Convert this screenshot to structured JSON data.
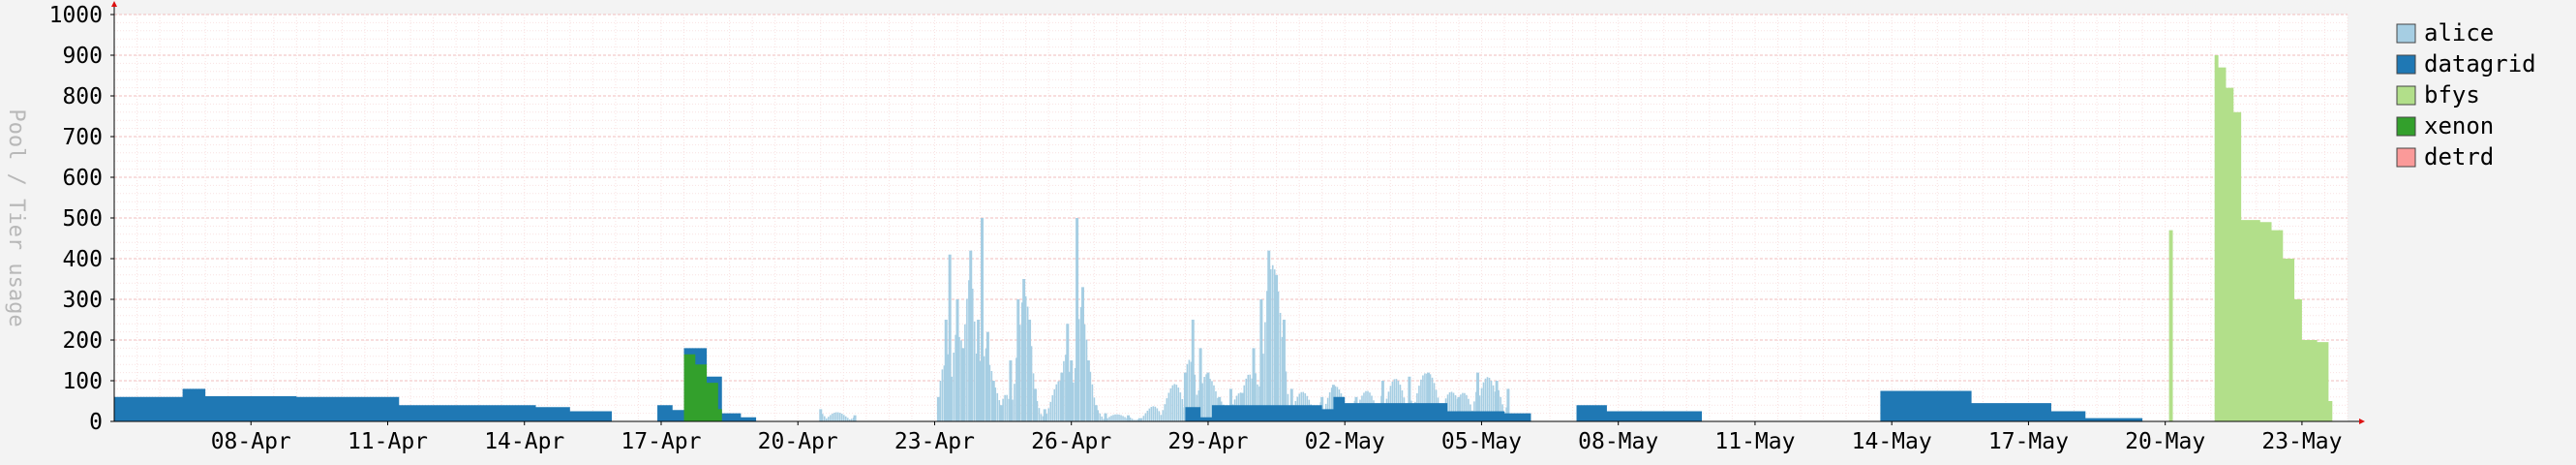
{
  "chart_data": {
    "type": "area",
    "title": "",
    "xlabel": "",
    "ylabel": "Pool / Tier usage",
    "ylim": [
      0,
      1000
    ],
    "yticks": [
      0,
      100,
      200,
      300,
      400,
      500,
      600,
      700,
      800,
      900,
      1000
    ],
    "xlim": [
      "2024-04-05",
      "2024-05-24"
    ],
    "xticks": [
      "08-Apr",
      "11-Apr",
      "14-Apr",
      "17-Apr",
      "20-Apr",
      "23-Apr",
      "26-Apr",
      "29-Apr",
      "02-May",
      "05-May",
      "08-May",
      "11-May",
      "14-May",
      "17-May",
      "20-May",
      "23-May"
    ],
    "xtick_dates": [
      "2024-04-08",
      "2024-04-11",
      "2024-04-14",
      "2024-04-17",
      "2024-04-20",
      "2024-04-23",
      "2024-04-26",
      "2024-04-29",
      "2024-05-02",
      "2024-05-05",
      "2024-05-08",
      "2024-05-11",
      "2024-05-14",
      "2024-05-17",
      "2024-05-20",
      "2024-05-23"
    ],
    "grid": true,
    "legend_position": "right",
    "series": [
      {
        "name": "alice",
        "color": "#a6cee3",
        "style": "spikes",
        "points": [
          [
            "2024-04-20 12:00",
            30
          ],
          [
            "2024-04-21 06:00",
            15
          ],
          [
            "2024-04-23 02:00",
            60
          ],
          [
            "2024-04-23 06:00",
            250
          ],
          [
            "2024-04-23 08:00",
            410
          ],
          [
            "2024-04-23 12:00",
            300
          ],
          [
            "2024-04-23 15:00",
            180
          ],
          [
            "2024-04-23 19:00",
            420
          ],
          [
            "2024-04-23 23:00",
            250
          ],
          [
            "2024-04-24 01:00",
            500
          ],
          [
            "2024-04-24 04:00",
            220
          ],
          [
            "2024-04-24 07:00",
            100
          ],
          [
            "2024-04-24 11:00",
            40
          ],
          [
            "2024-04-24 16:00",
            150
          ],
          [
            "2024-04-24 20:00",
            300
          ],
          [
            "2024-04-24 23:00",
            350
          ],
          [
            "2024-04-25 02:00",
            250
          ],
          [
            "2024-04-25 05:00",
            80
          ],
          [
            "2024-04-25 10:00",
            30
          ],
          [
            "2024-04-25 19:00",
            120
          ],
          [
            "2024-04-25 22:00",
            240
          ],
          [
            "2024-04-26 00:00",
            150
          ],
          [
            "2024-04-26 03:00",
            500
          ],
          [
            "2024-04-26 06:00",
            330
          ],
          [
            "2024-04-26 09:00",
            150
          ],
          [
            "2024-04-26 13:00",
            40
          ],
          [
            "2024-04-26 18:00",
            20
          ],
          [
            "2024-04-27 06:00",
            15
          ],
          [
            "2024-04-27 12:00",
            8
          ],
          [
            "2024-04-28 12:00",
            120
          ],
          [
            "2024-04-28 16:00",
            250
          ],
          [
            "2024-04-28 20:00",
            180
          ],
          [
            "2024-04-29 00:00",
            120
          ],
          [
            "2024-04-29 06:00",
            60
          ],
          [
            "2024-04-29 12:00",
            80
          ],
          [
            "2024-04-29 18:00",
            70
          ],
          [
            "2024-04-30 00:00",
            180
          ],
          [
            "2024-04-30 04:00",
            300
          ],
          [
            "2024-04-30 08:00",
            420
          ],
          [
            "2024-04-30 12:00",
            360
          ],
          [
            "2024-04-30 16:00",
            250
          ],
          [
            "2024-04-30 20:00",
            80
          ],
          [
            "2024-05-01 12:00",
            60
          ],
          [
            "2024-05-01 18:00",
            90
          ],
          [
            "2024-05-02 06:00",
            60
          ],
          [
            "2024-05-02 20:00",
            100
          ],
          [
            "2024-05-03 10:00",
            110
          ],
          [
            "2024-05-03 20:00",
            120
          ],
          [
            "2024-05-04 12:00",
            60
          ],
          [
            "2024-05-04 22:00",
            120
          ],
          [
            "2024-05-05 08:00",
            100
          ],
          [
            "2024-05-05 14:00",
            80
          ]
        ]
      },
      {
        "name": "datagrid",
        "color": "#1f78b4",
        "style": "step",
        "points": [
          [
            "2024-04-05 00:00",
            60
          ],
          [
            "2024-04-06 00:00",
            60
          ],
          [
            "2024-04-06 12:00",
            80
          ],
          [
            "2024-04-07 00:00",
            62
          ],
          [
            "2024-04-09 00:00",
            60
          ],
          [
            "2024-04-10 00:00",
            60
          ],
          [
            "2024-04-11 06:00",
            40
          ],
          [
            "2024-04-13 12:00",
            40
          ],
          [
            "2024-04-14 06:00",
            35
          ],
          [
            "2024-04-15 00:00",
            25
          ],
          [
            "2024-04-15 22:00",
            0
          ],
          [
            "2024-04-16 22:00",
            40
          ],
          [
            "2024-04-17 06:00",
            28
          ],
          [
            "2024-04-17 12:00",
            180
          ],
          [
            "2024-04-18 00:00",
            110
          ],
          [
            "2024-04-18 08:00",
            20
          ],
          [
            "2024-04-18 18:00",
            10
          ],
          [
            "2024-04-19 02:00",
            0
          ],
          [
            "2024-04-28 12:00",
            35
          ],
          [
            "2024-04-28 20:00",
            10
          ],
          [
            "2024-04-29 02:00",
            40
          ],
          [
            "2024-05-01 12:00",
            30
          ],
          [
            "2024-05-01 18:00",
            60
          ],
          [
            "2024-05-02 00:00",
            45
          ],
          [
            "2024-05-04 06:00",
            25
          ],
          [
            "2024-05-05 12:00",
            20
          ],
          [
            "2024-05-06 02:00",
            0
          ],
          [
            "2024-05-07 02:00",
            40
          ],
          [
            "2024-05-07 18:00",
            25
          ],
          [
            "2024-05-09 20:00",
            0
          ],
          [
            "2024-05-13 18:00",
            75
          ],
          [
            "2024-05-15 18:00",
            45
          ],
          [
            "2024-05-17 12:00",
            25
          ],
          [
            "2024-05-18 06:00",
            8
          ],
          [
            "2024-05-19 12:00",
            0
          ]
        ]
      },
      {
        "name": "bfys",
        "color": "#b2df8a",
        "style": "step",
        "points": [
          [
            "2024-05-20 00:00",
            0
          ],
          [
            "2024-05-20 02:00",
            470
          ],
          [
            "2024-05-20 04:00",
            0
          ],
          [
            "2024-05-21 02:00",
            900
          ],
          [
            "2024-05-21 04:00",
            870
          ],
          [
            "2024-05-21 08:00",
            820
          ],
          [
            "2024-05-21 12:00",
            760
          ],
          [
            "2024-05-21 16:00",
            495
          ],
          [
            "2024-05-22 02:00",
            490
          ],
          [
            "2024-05-22 08:00",
            470
          ],
          [
            "2024-05-22 14:00",
            400
          ],
          [
            "2024-05-22 20:00",
            300
          ],
          [
            "2024-05-23 00:00",
            200
          ],
          [
            "2024-05-23 08:00",
            195
          ],
          [
            "2024-05-23 14:00",
            50
          ],
          [
            "2024-05-23 16:00",
            0
          ]
        ]
      },
      {
        "name": "xenon",
        "color": "#33a02c",
        "style": "step",
        "points": [
          [
            "2024-04-17 12:00",
            165
          ],
          [
            "2024-04-17 18:00",
            140
          ],
          [
            "2024-04-18 00:00",
            95
          ],
          [
            "2024-04-18 06:00",
            30
          ],
          [
            "2024-04-18 08:00",
            0
          ]
        ]
      },
      {
        "name": "detrd",
        "color": "#fb9a99",
        "style": "step",
        "points": []
      }
    ]
  }
}
